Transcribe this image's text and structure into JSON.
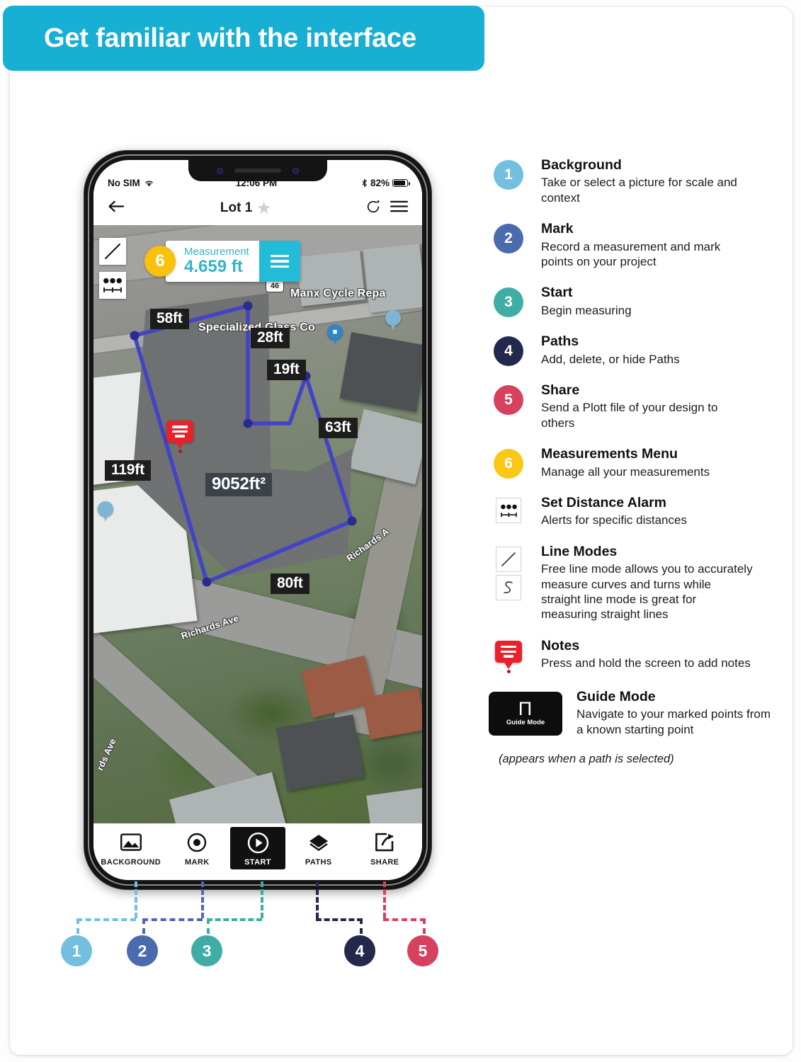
{
  "header": {
    "title": "Get familiar with the interface",
    "accent": "#17b0d4"
  },
  "phone": {
    "status": {
      "carrier": "No SIM",
      "wifi_icon": "wifi-icon",
      "time": "12:06 PM",
      "bluetooth_icon": "bluetooth-icon",
      "battery_percent": "82%"
    },
    "nav": {
      "back_icon": "back-arrow-icon",
      "title": "Lot 1",
      "favorite_icon": "star-icon",
      "undo_icon": "refresh-undo-icon",
      "menu_icon": "hamburger-menu-icon"
    },
    "tools": {
      "line_mode_icon": "diagonal-line-icon",
      "distance_alarm_icon": "distance-alarm-icon"
    },
    "measurement_panel": {
      "badge": "6",
      "label": "Measurement",
      "value": "4.659 ft",
      "menu_icon": "measurements-menu-icon",
      "label_color": "#35b3c6",
      "menu_color": "#22bcd8",
      "badge_color": "#f9c00c"
    },
    "map": {
      "area_label": "9052ft²",
      "edge_labels": [
        "58ft",
        "28ft",
        "19ft",
        "63ft",
        "119ft",
        "80ft"
      ],
      "place_labels": [
        "Specialized Glass Co",
        "Manx Cycle Repa"
      ],
      "street_labels": [
        "Richards Ave",
        "Richards A",
        "rds Ave"
      ],
      "route_shield": "46",
      "note_icon": "note-pin-icon",
      "polygon_color": "#4343c8"
    },
    "toolbar": [
      {
        "label": "BACKGROUND",
        "icon": "image-icon",
        "active": false
      },
      {
        "label": "MARK",
        "icon": "target-dot-icon",
        "active": false
      },
      {
        "label": "START",
        "icon": "play-circle-icon",
        "active": true
      },
      {
        "label": "PATHS",
        "icon": "layers-diamond-icon",
        "active": false
      },
      {
        "label": "SHARE",
        "icon": "share-box-icon",
        "active": false
      }
    ]
  },
  "callouts": [
    {
      "num": "1",
      "color": "#72bfe0"
    },
    {
      "num": "2",
      "color": "#4c6bae"
    },
    {
      "num": "3",
      "color": "#3fada5"
    },
    {
      "num": "4",
      "color": "#23294c"
    },
    {
      "num": "5",
      "color": "#d6415e"
    }
  ],
  "legend": {
    "numbered": [
      {
        "num": "1",
        "color": "#72bfe0",
        "title": "Background",
        "desc": "Take or select a picture for scale and context"
      },
      {
        "num": "2",
        "color": "#4c6bae",
        "title": "Mark",
        "desc": "Record a measurement and mark points on your project"
      },
      {
        "num": "3",
        "color": "#3fada5",
        "title": "Start",
        "desc": "Begin measuring"
      },
      {
        "num": "4",
        "color": "#23294c",
        "title": "Paths",
        "desc": "Add, delete, or hide Paths"
      },
      {
        "num": "5",
        "color": "#d6415e",
        "title": "Share",
        "desc": "Send a Plott file of your design to others"
      },
      {
        "num": "6",
        "color": "#f9c816",
        "title": "Measurements Menu",
        "desc": "Manage all your measurements"
      }
    ],
    "icon_rows": [
      {
        "icon": "distance-alarm-icon",
        "title": "Set Distance Alarm",
        "desc": "Alerts for specific distances"
      },
      {
        "icon": "line-modes-icon",
        "title": "Line Modes",
        "desc": "Free line mode allows you to accurately measure curves and turns while straight line mode is great for measuring straight lines"
      },
      {
        "icon": "note-pin-icon",
        "title": "Notes",
        "desc": "Press and hold the screen to add notes"
      }
    ],
    "guide_mode": {
      "icon_label": "Guide Mode",
      "icon_glyph": "Π",
      "title": "Guide Mode",
      "desc": "Navigate to your marked points from a known starting point",
      "footnote": "(appears when a path is selected)"
    }
  }
}
